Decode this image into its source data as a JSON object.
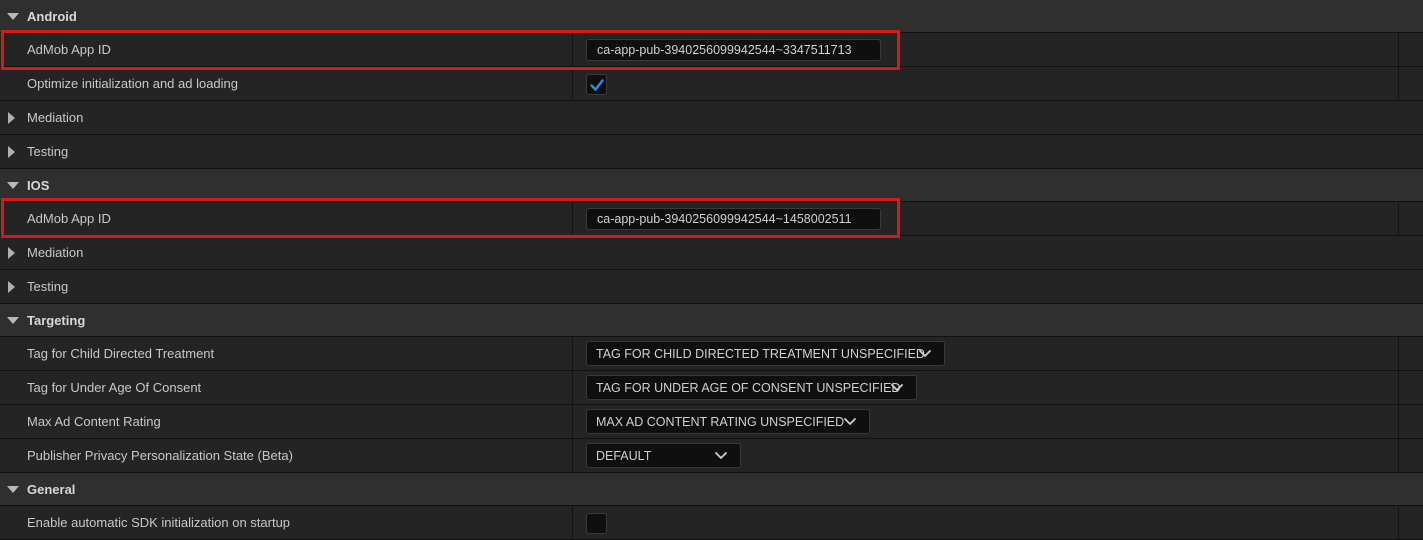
{
  "sections": {
    "android": {
      "title": "Android",
      "admob_label": "AdMob App ID",
      "admob_value": "ca-app-pub-3940256099942544~3347511713",
      "optimize_label": "Optimize initialization and ad loading",
      "optimize_checked": true,
      "mediation_label": "Mediation",
      "testing_label": "Testing"
    },
    "ios": {
      "title": "IOS",
      "admob_label": "AdMob App ID",
      "admob_value": "ca-app-pub-3940256099942544~1458002511",
      "mediation_label": "Mediation",
      "testing_label": "Testing"
    },
    "targeting": {
      "title": "Targeting",
      "child_label": "Tag for Child Directed Treatment",
      "child_value": "TAG FOR CHILD DIRECTED TREATMENT UNSPECIFIED",
      "underage_label": "Tag for Under Age Of Consent",
      "underage_value": "TAG FOR UNDER AGE OF CONSENT UNSPECIFIED",
      "rating_label": "Max Ad Content Rating",
      "rating_value": "MAX AD CONTENT RATING UNSPECIFIED",
      "privacy_label": "Publisher Privacy Personalization State (Beta)",
      "privacy_value": "DEFAULT"
    },
    "general": {
      "title": "General",
      "auto_init_label": "Enable automatic SDK initialization on startup",
      "auto_init_checked": false
    }
  },
  "colors": {
    "accent_check": "#2a8cf0",
    "highlight": "#d11a1a"
  }
}
